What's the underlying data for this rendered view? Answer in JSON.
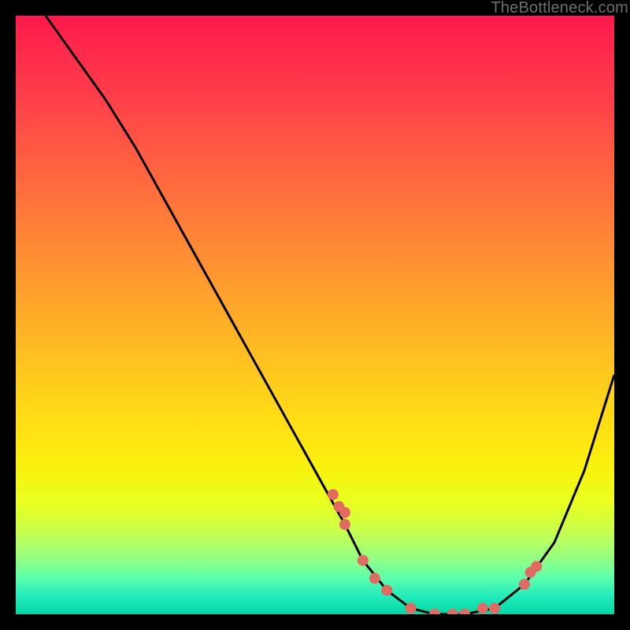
{
  "watermark": "TheBottleneck.com",
  "chart_data": {
    "type": "line",
    "title": "",
    "xlabel": "",
    "ylabel": "",
    "xlim": [
      0,
      100
    ],
    "ylim": [
      0,
      100
    ],
    "grid": false,
    "series": [
      {
        "name": "curve",
        "x": [
          5,
          10,
          15,
          20,
          25,
          30,
          35,
          40,
          45,
          50,
          55,
          58,
          62,
          66,
          70,
          75,
          80,
          85,
          90,
          95,
          100
        ],
        "y": [
          100,
          93,
          86,
          78,
          69,
          60,
          51,
          42,
          33,
          24,
          15,
          9,
          4,
          1,
          0,
          0,
          1,
          5,
          12,
          24,
          40
        ]
      }
    ],
    "markers": {
      "name": "highlighted-points",
      "color": "#e36a62",
      "x": [
        53,
        54,
        55,
        55,
        58,
        60,
        62,
        66,
        70,
        73,
        75,
        78,
        80,
        85,
        86,
        87
      ],
      "y": [
        20,
        18,
        17,
        15,
        9,
        6,
        4,
        1,
        0,
        0,
        0,
        1,
        1,
        5,
        7,
        8
      ]
    },
    "background_gradient": {
      "top": "#ff1a4d",
      "middle": "#ffe312",
      "bottom": "#05d6a6"
    }
  }
}
